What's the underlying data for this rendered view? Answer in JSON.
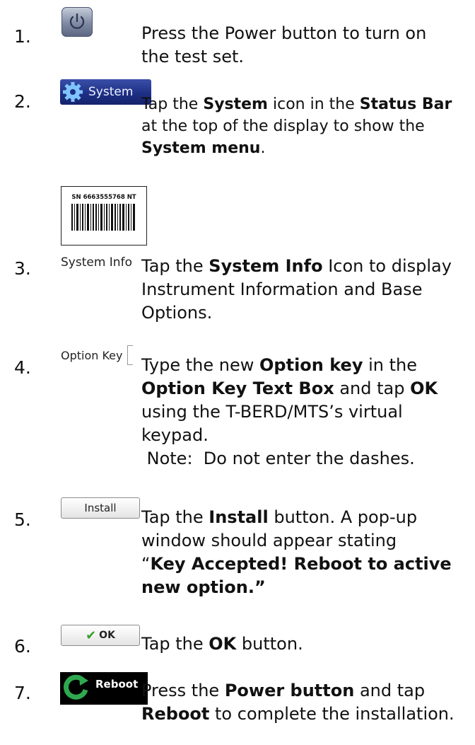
{
  "steps": [
    {
      "number": "1.",
      "icon": "power-icon",
      "lines": [
        "Press the Power button to turn on",
        "the test set."
      ]
    },
    {
      "number": "2.",
      "icon": "gear-icon",
      "icon_label": "System",
      "l1": [
        "Tap the ",
        "System",
        " icon in the ",
        "Status Bar"
      ],
      "l2": "at the top of the display to show the",
      "l3": [
        "System menu",
        "."
      ]
    },
    {
      "number": "3.",
      "icon": "barcode-icon",
      "barcode_text": "SN 6663555768 NT",
      "icon_label": "System Info",
      "l1": [
        "Tap the ",
        "System Info",
        " Icon to display"
      ],
      "l2": "Instrument Information and Base",
      "l3": "Options."
    },
    {
      "number": "4.",
      "icon_label": "Option Key",
      "l1": [
        "Type the new ",
        "Option key",
        " in the"
      ],
      "l2": [
        "Option Key Text Box",
        " and tap ",
        "OK"
      ],
      "l3": "using the T-BERD/MTS’s virtual",
      "l4": "keypad.",
      "l5": " Note:  Do not enter the dashes."
    },
    {
      "number": "5.",
      "button_label": "Install",
      "l1": [
        "Tap the ",
        "Install",
        " button.  A pop-up"
      ],
      "l2": "window should appear stating",
      "l3": [
        "“",
        "Key Accepted!  Reboot to active"
      ],
      "l4": [
        "new option.”"
      ]
    },
    {
      "number": "6.",
      "button_label": "OK",
      "l1": [
        "Tap the ",
        "OK",
        " button."
      ]
    },
    {
      "number": "7.",
      "icon": "reboot-icon",
      "icon_label": "Reboot",
      "l1": [
        "Press the ",
        "Power button",
        " and tap"
      ],
      "l2": [
        "Reboot",
        " to complete the installation."
      ]
    }
  ],
  "colors": {
    "check": "#38a12a",
    "reboot_arrow": "#2fa84f",
    "system_bg": "#1c2e83"
  }
}
